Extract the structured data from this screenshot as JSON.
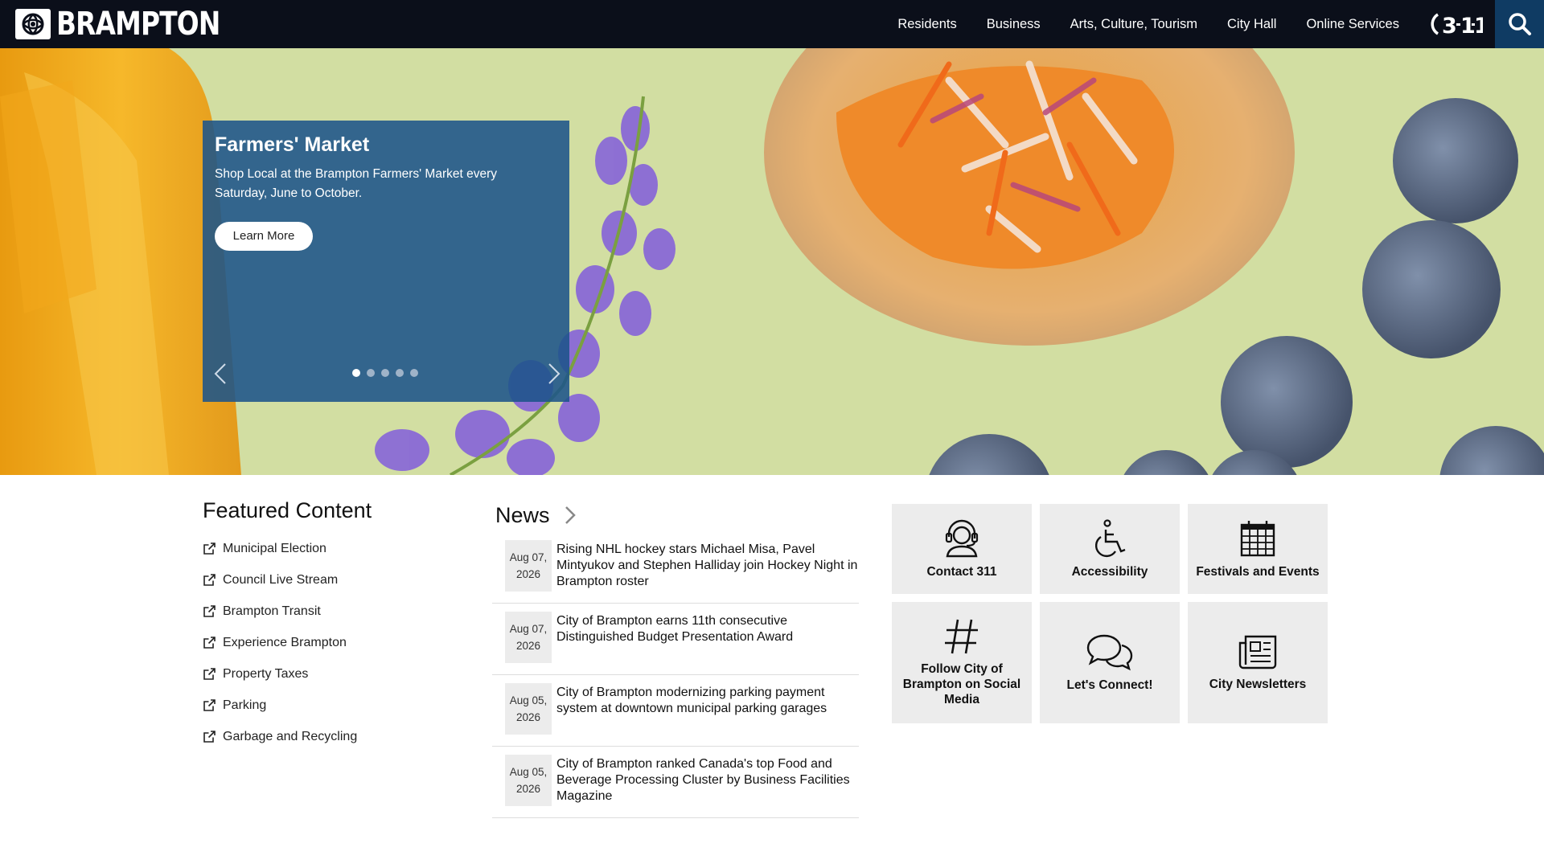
{
  "header": {
    "logo_text": "BRAMPTON",
    "nav": [
      "Residents",
      "Business",
      "Arts, Culture, Tourism",
      "City Hall",
      "Online Services"
    ],
    "btn_311": "3-1-1",
    "search_icon": "search-icon"
  },
  "hero": {
    "title": "Farmers' Market",
    "text": "Shop Local at the Brampton Farmers' Market every Saturday, June to October.",
    "button": "Learn More",
    "slide_count": 5,
    "active_slide": 1
  },
  "featured": {
    "title": "Featured Content",
    "items": [
      "Municipal Election",
      "Council Live Stream",
      "Brampton Transit",
      "Experience Brampton",
      "Property Taxes",
      "Parking",
      "Garbage and Recycling"
    ]
  },
  "news": {
    "title": "News",
    "items": [
      {
        "date_line1": "Aug 07,",
        "date_line2": "2026",
        "title": "Rising NHL hockey stars Michael Misa, Pavel Mintyukov and Stephen Halliday join Hockey Night in Brampton roster"
      },
      {
        "date_line1": "Aug 07,",
        "date_line2": "2026",
        "title": "City of Brampton earns 11th consecutive Distinguished Budget Presentation Award"
      },
      {
        "date_line1": "Aug 05,",
        "date_line2": "2026",
        "title": "City of Brampton modernizing parking payment system at downtown municipal parking garages"
      },
      {
        "date_line1": "Aug 05,",
        "date_line2": "2026",
        "title": "City of Brampton ranked Canada's top Food and Beverage Processing Cluster by Business Facilities Magazine"
      }
    ]
  },
  "tiles": [
    {
      "label": "Contact 311",
      "icon": "headset-icon"
    },
    {
      "label": "Accessibility",
      "icon": "wheelchair-icon"
    },
    {
      "label": "Festivals and Events",
      "icon": "calendar-icon"
    },
    {
      "label": "Follow City of Brampton on Social Media",
      "icon": "hashtag-icon"
    },
    {
      "label": "Let's Connect!",
      "icon": "chat-bubbles-icon"
    },
    {
      "label": "City Newsletters",
      "icon": "newspaper-icon"
    }
  ],
  "colors": {
    "header_bg": "#0b0f1a",
    "search_bg": "#0f3b63",
    "hero_bg": "#d2dea2",
    "slide_panel": "#1c548a",
    "tile_bg": "#ececec"
  }
}
